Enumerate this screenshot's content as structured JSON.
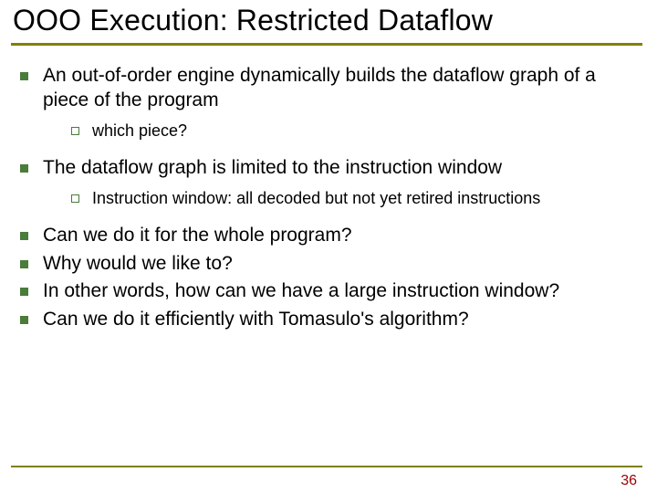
{
  "title": "OOO Execution: Restricted Dataflow",
  "bullets": [
    {
      "text": "An out-of-order engine dynamically builds the dataflow graph of a piece of the program",
      "sub": [
        {
          "text": "which piece?"
        }
      ]
    },
    {
      "text": "The dataflow graph is limited to the instruction window",
      "sub": [
        {
          "text": "Instruction window: all decoded but not yet retired instructions"
        }
      ]
    },
    {
      "text": "Can we do it for the whole program?"
    },
    {
      "text": "Why would we like to?"
    },
    {
      "text": "In other words, how can we have a large instruction window?"
    },
    {
      "text": "Can we do it efficiently with Tomasulo's algorithm?"
    }
  ],
  "page_number": "36"
}
